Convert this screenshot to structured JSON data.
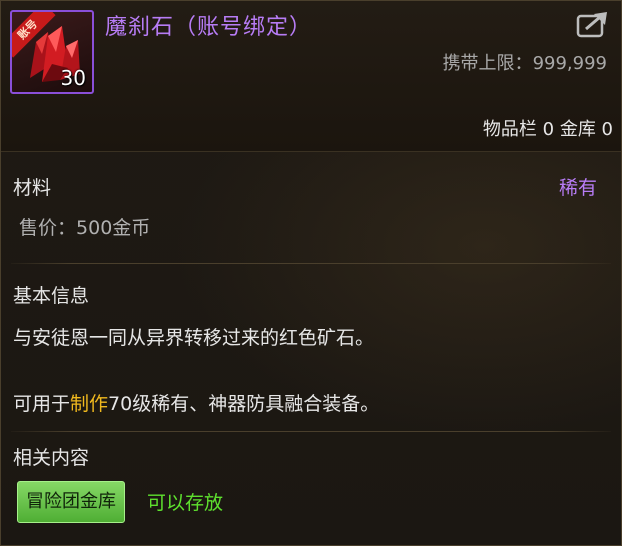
{
  "item": {
    "name": "魔刹石（账号绑定）",
    "ribbon_label": "账号",
    "stack_count": "30",
    "icon": "red-crystal-icon",
    "carry_label": "携带上限：",
    "carry_value": "999,999",
    "storage_text": "物品栏 0 金库 0"
  },
  "meta": {
    "type": "材料",
    "rarity": "稀有",
    "price_label": "售价：",
    "price_value": "500金币"
  },
  "basic_info": {
    "title": "基本信息",
    "line1": "与安徒恩一同从异界转移过来的红色矿石。",
    "line2_prefix": "可用于",
    "line2_highlight": "制作",
    "line2_suffix": "70级稀有、神器防具融合装备。"
  },
  "related": {
    "title": "相关内容",
    "tag_label": "冒险团金库",
    "tag_note": "可以存放"
  },
  "colors": {
    "name_purple": "#b77cf5",
    "highlight_gold": "#f0b91e",
    "green": "#5ee02e"
  }
}
